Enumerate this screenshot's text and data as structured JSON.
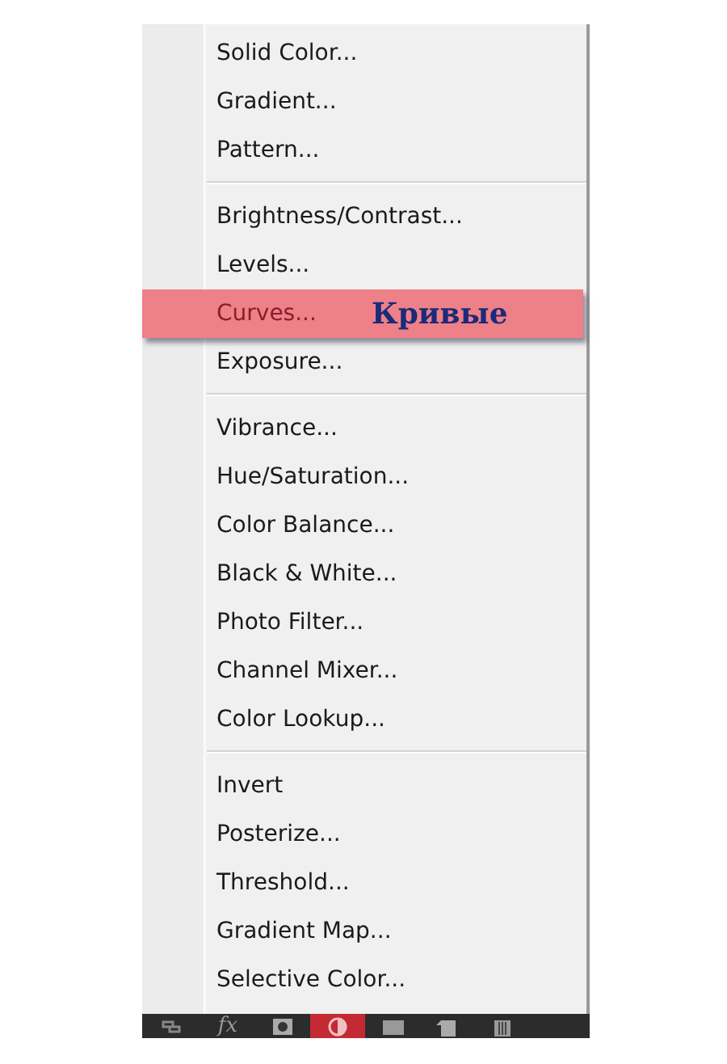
{
  "menu": {
    "groups": [
      {
        "items": [
          {
            "label": "Solid Color...",
            "selected": false
          },
          {
            "label": "Gradient...",
            "selected": false
          },
          {
            "label": "Pattern...",
            "selected": false
          }
        ]
      },
      {
        "items": [
          {
            "label": "Brightness/Contrast...",
            "selected": false
          },
          {
            "label": "Levels...",
            "selected": false
          },
          {
            "label": "Curves...",
            "selected": true,
            "annotation": "Кривые"
          },
          {
            "label": "Exposure...",
            "selected": false
          }
        ]
      },
      {
        "items": [
          {
            "label": "Vibrance...",
            "selected": false
          },
          {
            "label": "Hue/Saturation...",
            "selected": false
          },
          {
            "label": "Color Balance...",
            "selected": false
          },
          {
            "label": "Black & White...",
            "selected": false
          },
          {
            "label": "Photo Filter...",
            "selected": false
          },
          {
            "label": "Channel Mixer...",
            "selected": false
          },
          {
            "label": "Color Lookup...",
            "selected": false
          }
        ]
      },
      {
        "items": [
          {
            "label": "Invert",
            "selected": false
          },
          {
            "label": "Posterize...",
            "selected": false
          },
          {
            "label": "Threshold...",
            "selected": false
          },
          {
            "label": "Gradient Map...",
            "selected": false
          },
          {
            "label": "Selective Color...",
            "selected": false
          }
        ]
      }
    ]
  },
  "toolbar": [
    {
      "kind": "link",
      "selected": false
    },
    {
      "kind": "fx",
      "label": "fx",
      "selected": false
    },
    {
      "kind": "mask",
      "selected": false
    },
    {
      "kind": "adjustment",
      "selected": true
    },
    {
      "kind": "folder",
      "selected": false
    },
    {
      "kind": "new",
      "selected": false
    },
    {
      "kind": "trash",
      "selected": false
    }
  ]
}
